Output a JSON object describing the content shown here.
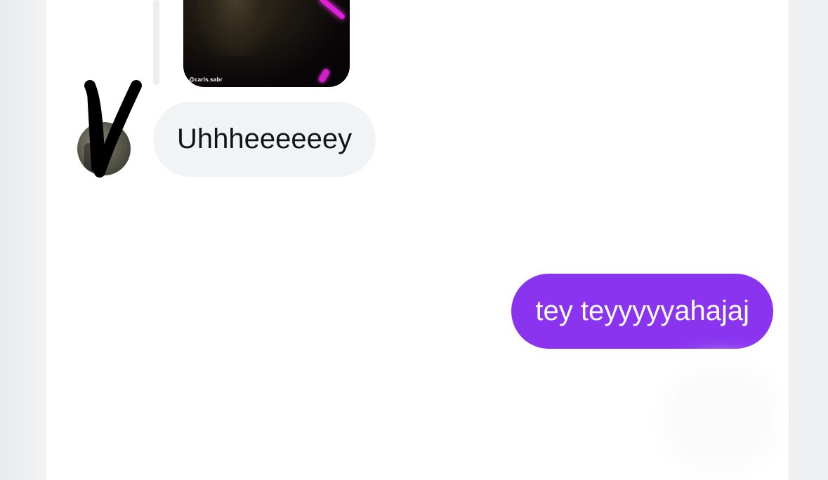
{
  "thread": {
    "shared_media": {
      "watermark": "@carls.sabr"
    },
    "received_message": {
      "text": "Uhhheeeeeey"
    },
    "sent_message": {
      "text": "tey teyyyyyahajaj"
    }
  },
  "colors": {
    "sent_bubble": "#8a34f0",
    "received_bubble": "#f2f3f5",
    "scribble": "#000000"
  },
  "icons": {
    "sender_avatar": "avatar-photo"
  }
}
